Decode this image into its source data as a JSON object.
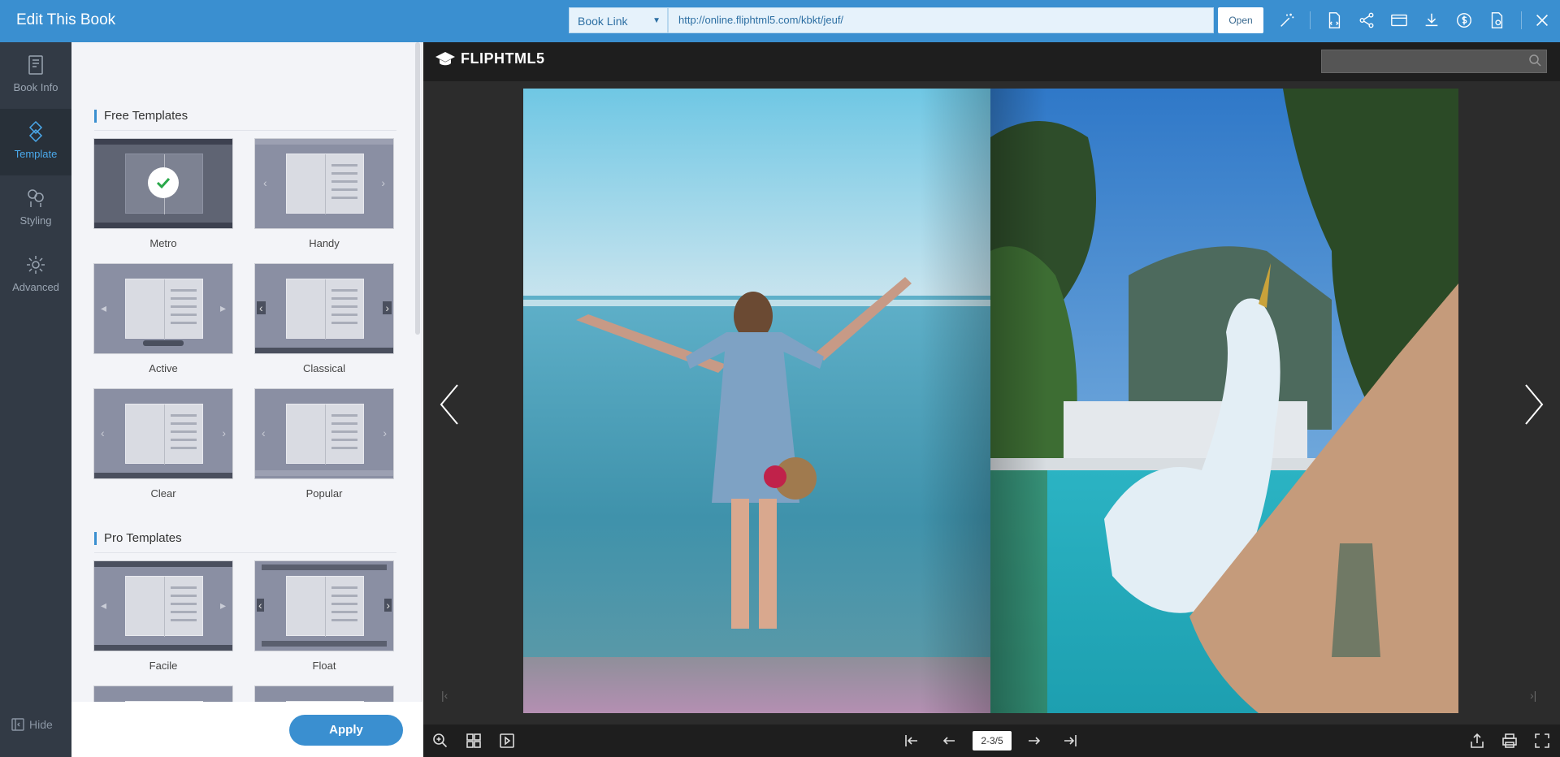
{
  "header": {
    "title": "Edit This Book",
    "link_type": "Book Link",
    "url": "http://online.fliphtml5.com/kbkt/jeuf/",
    "open_label": "Open"
  },
  "sidebar": {
    "items": [
      {
        "label": "Book Info",
        "icon": "book-info-icon"
      },
      {
        "label": "Template",
        "icon": "template-icon",
        "active": true
      },
      {
        "label": "Styling",
        "icon": "styling-icon"
      },
      {
        "label": "Advanced",
        "icon": "gear-icon"
      }
    ],
    "hide_label": "Hide"
  },
  "templates": {
    "free_title": "Free Templates",
    "pro_title": "Pro Templates",
    "free": [
      "Metro",
      "Handy",
      "Active",
      "Classical",
      "Clear",
      "Popular"
    ],
    "pro": [
      "Facile",
      "Float"
    ],
    "selected": "Metro",
    "apply_label": "Apply"
  },
  "viewer": {
    "brand": "FLIPHTML5",
    "page_indicator": "2-3/5"
  },
  "colors": {
    "accent": "#3a8fd0",
    "sidebar_bg": "#323a45",
    "viewer_bg": "#2c2c2c"
  }
}
